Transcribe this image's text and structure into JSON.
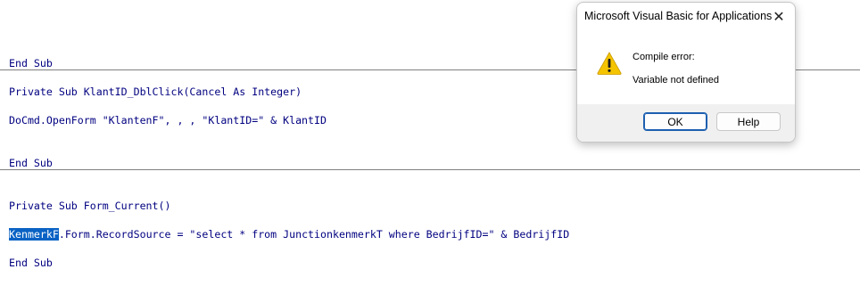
{
  "code": {
    "line1": "End Sub",
    "line2": "Private Sub KlantID_DblClick(Cancel As Integer)",
    "line3": "DoCmd.OpenForm \"KlantenF\", , , \"KlantID=\" & KlantID",
    "line4": "End Sub",
    "line5": "Private Sub Form_Current()",
    "line6_selected": "KenmerkF",
    "line6_rest": ".Form.RecordSource = \"select * from JunctionkenmerkT where BedrijfID=\" & BedrijfID",
    "line7": "End Sub"
  },
  "dialog": {
    "title": "Microsoft Visual Basic for Applications",
    "close_glyph": "✕",
    "icon": "warning-icon",
    "message_heading": "Compile error:",
    "message_body": "Variable not defined",
    "ok_label": "OK",
    "help_label": "Help"
  },
  "colors": {
    "code_text": "#000080",
    "selection": "#0a62c4",
    "warning_fill": "#f5c400"
  }
}
